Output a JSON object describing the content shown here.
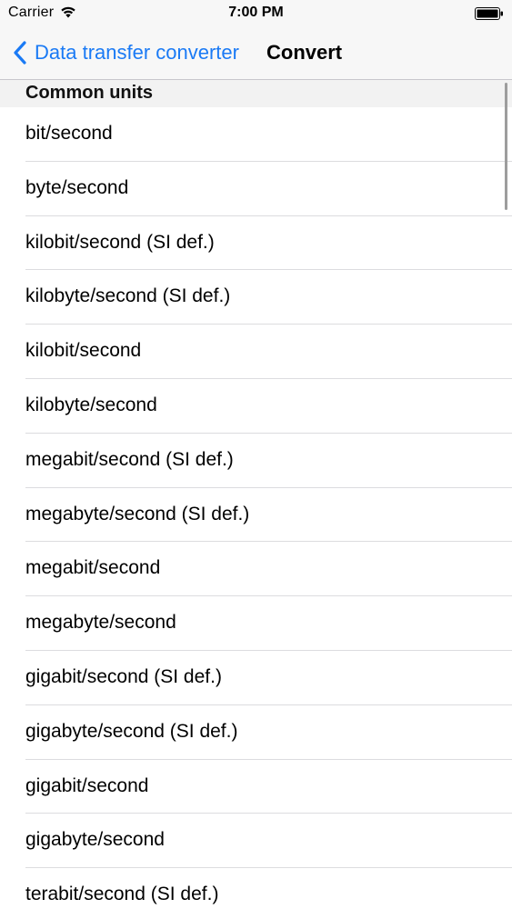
{
  "status_bar": {
    "carrier": "Carrier",
    "time": "7:00 PM",
    "icons": [
      "wifi-icon",
      "battery-icon"
    ]
  },
  "nav": {
    "back_label": "Data transfer converter",
    "title": "Convert",
    "accent_color": "#1a7af5"
  },
  "section": {
    "header": "Common units"
  },
  "units": [
    "bit/second",
    "byte/second",
    "kilobit/second (SI def.)",
    "kilobyte/second (SI def.)",
    "kilobit/second",
    "kilobyte/second",
    "megabit/second (SI def.)",
    "megabyte/second (SI def.)",
    "megabit/second",
    "megabyte/second",
    "gigabit/second (SI def.)",
    "gigabyte/second (SI def.)",
    "gigabit/second",
    "gigabyte/second",
    "terabit/second (SI def.)"
  ]
}
